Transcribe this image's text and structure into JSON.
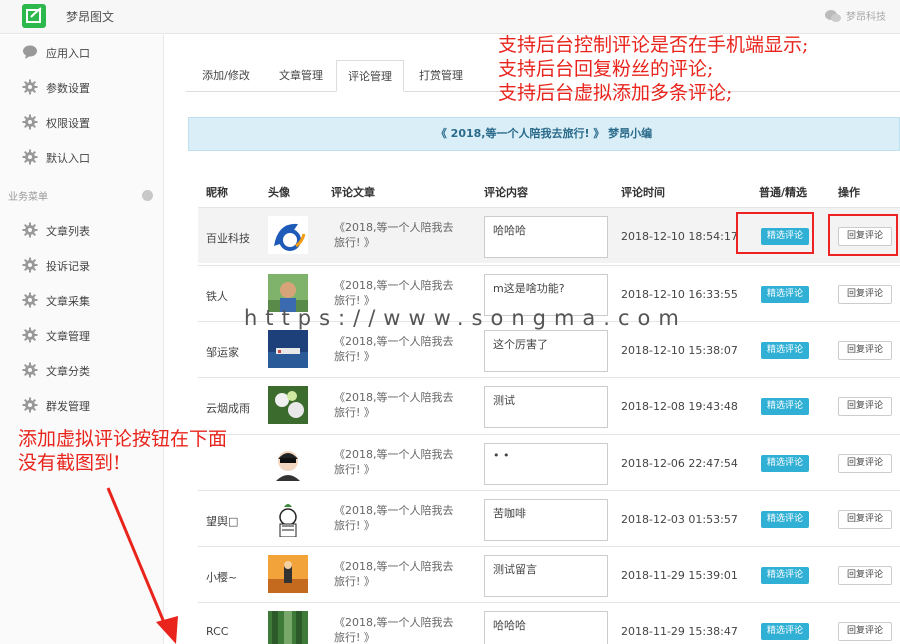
{
  "header": {
    "app_title": "梦昂图文",
    "brand": "梦昂科技"
  },
  "sidebar": {
    "items_top": [
      {
        "label": "应用入口",
        "icon": "chat-bubble-icon"
      },
      {
        "label": "参数设置",
        "icon": "gear-icon"
      },
      {
        "label": "权限设置",
        "icon": "gear-icon"
      },
      {
        "label": "默认入口",
        "icon": "gear-icon"
      }
    ],
    "section_label": "业务菜单",
    "items_business": [
      {
        "label": "文章列表",
        "icon": "gear-icon"
      },
      {
        "label": "投诉记录",
        "icon": "gear-icon"
      },
      {
        "label": "文章采集",
        "icon": "gear-icon"
      },
      {
        "label": "文章管理",
        "icon": "gear-icon"
      },
      {
        "label": "文章分类",
        "icon": "gear-icon"
      },
      {
        "label": "群发管理",
        "icon": "gear-icon"
      }
    ]
  },
  "tabs": [
    {
      "label": "添加/修改",
      "active": false
    },
    {
      "label": "文章管理",
      "active": false
    },
    {
      "label": "评论管理",
      "active": true
    },
    {
      "label": "打赏管理",
      "active": false
    }
  ],
  "banner": "《 2018,等一个人陪我去旅行! 》 梦昂小编",
  "table": {
    "headers": [
      "昵称",
      "头像",
      "评论文章",
      "评论内容",
      "评论时间",
      "普通/精选",
      "操作"
    ],
    "feature_label": "精选评论",
    "reply_label": "回复评论",
    "rows": [
      {
        "name": "百业科技",
        "article": "《2018,等一个人陪我去旅行! 》",
        "content": "哈哈哈",
        "time": "2018-12-10 18:54:17"
      },
      {
        "name": "铁人",
        "article": "《2018,等一个人陪我去旅行! 》",
        "content": "m这是啥功能?",
        "time": "2018-12-10 16:33:55"
      },
      {
        "name": "邹运家",
        "article": "《2018,等一个人陪我去旅行! 》",
        "content": "这个厉害了",
        "time": "2018-12-10 15:38:07"
      },
      {
        "name": "云烟成雨",
        "article": "《2018,等一个人陪我去旅行! 》",
        "content": "测试",
        "time": "2018-12-08 19:43:48"
      },
      {
        "name": "",
        "article": "《2018,等一个人陪我去旅行! 》",
        "content": "• •",
        "time": "2018-12-06 22:47:54"
      },
      {
        "name": "望舆□",
        "article": "《2018,等一个人陪我去旅行! 》",
        "content": "苦咖啡",
        "time": "2018-12-03 01:53:57"
      },
      {
        "name": "小樱~",
        "article": "《2018,等一个人陪我去旅行! 》",
        "content": "测试留言",
        "time": "2018-11-29 15:39:01"
      },
      {
        "name": "RCC",
        "article": "《2018,等一个人陪我去旅行! 》",
        "content": "哈哈哈",
        "time": "2018-11-29 15:38:47"
      }
    ]
  },
  "annotations": {
    "top_right": [
      "支持后台控制评论是否在手机端显示;",
      "支持后台回复粉丝的评论;",
      "支持后台虚拟添加多条评论;"
    ],
    "left": [
      "添加虚拟评论按钮在下面",
      "没有截图到!"
    ],
    "watermark": "https://www.songma.com"
  },
  "colors": {
    "accent": "#31b0d5",
    "annotation": "#e8241c",
    "logo": "#2db84d",
    "banner_bg": "#d9eef7"
  }
}
